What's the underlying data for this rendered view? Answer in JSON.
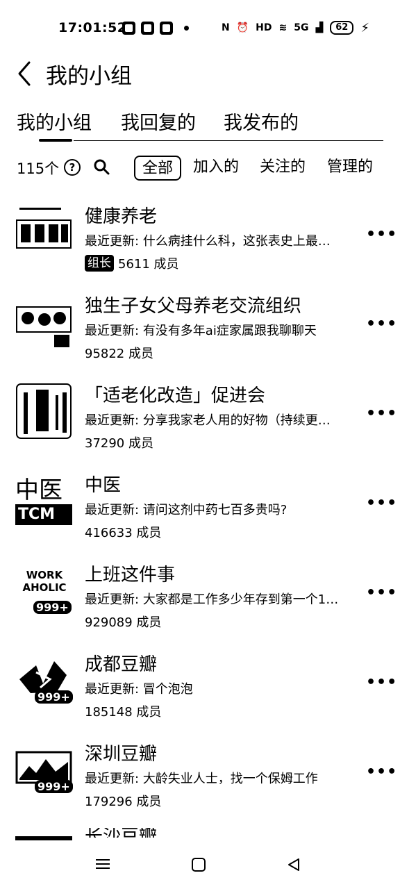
{
  "status_bar": {
    "time": "17:01:52",
    "signal_text": "5G",
    "battery": "62",
    "icons": [
      "app-icon",
      "app-icon",
      "app-icon",
      "dot-icon",
      "nfc-icon",
      "alarm-icon",
      "hd-icon",
      "wifi-icon",
      "signal-icon",
      "signal-icon",
      "battery-icon",
      "charging-icon"
    ]
  },
  "header": {
    "title": "我的小组"
  },
  "tabs": [
    {
      "label": "我的小组",
      "active": true
    },
    {
      "label": "我回复的",
      "active": false
    },
    {
      "label": "我发布的",
      "active": false
    }
  ],
  "filter": {
    "count": "115个",
    "chips": [
      {
        "label": "全部",
        "active": true
      },
      {
        "label": "加入的",
        "active": false
      },
      {
        "label": "关注的",
        "active": false
      },
      {
        "label": "管理的",
        "active": false
      }
    ]
  },
  "groups": [
    {
      "name": "健康养老",
      "update": "最近更新: 什么病挂什么科，这张表史上最…",
      "role": "组长",
      "members": "5611 成员"
    },
    {
      "name": "独生子女父母养老交流组织",
      "update": "最近更新: 有没有多年ai症家属跟我聊聊天",
      "role": "",
      "members": "95822 成员"
    },
    {
      "name": "「适老化改造」促进会",
      "update": "最近更新: 分享我家老人用的好物（持续更…",
      "role": "",
      "members": "37290 成员"
    },
    {
      "name": "中医",
      "update": "最近更新: 请问这剂中药七百多贵吗?",
      "role": "",
      "members": "416633 成员",
      "thumb_text": "中医",
      "thumb_sub": "TCM"
    },
    {
      "name": "上班这件事",
      "update": "最近更新: 大家都是工作多少年存到第一个1…",
      "role": "",
      "members": "929089 成员",
      "thumb_text": "WORK AHOLIC",
      "thumb_badge": "999+"
    },
    {
      "name": "成都豆瓣",
      "update": "最近更新: 冒个泡泡",
      "role": "",
      "members": "185148 成员",
      "thumb_badge": "999+"
    },
    {
      "name": "深圳豆瓣",
      "update": "最近更新: 大龄失业人士，找一个保姆工作",
      "role": "",
      "members": "179296 成员",
      "thumb_badge": "999+"
    }
  ],
  "partial_item": {
    "name": "长沙豆瓣"
  }
}
